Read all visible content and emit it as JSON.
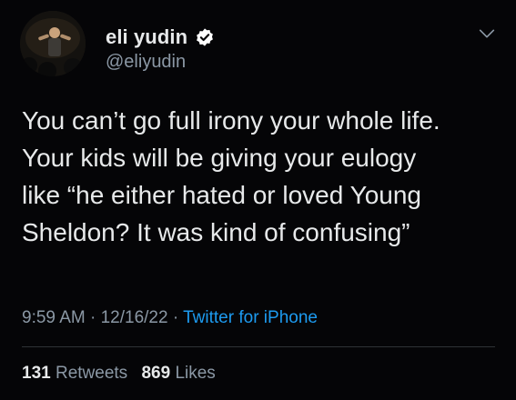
{
  "author": {
    "display_name": "eli yudin",
    "handle": "@eliyudin",
    "verified": true,
    "verified_color": "#ffffff",
    "avatar_icon": "avatar-photo"
  },
  "tweet": {
    "lines": [
      "You can’t go full irony your whole life.",
      "Your kids will be giving your eulogy",
      "like “he either hated or loved Young",
      "Sheldon? It was kind of confusing”"
    ]
  },
  "meta": {
    "time": "9:59 AM",
    "separator": "·",
    "date": "12/16/22",
    "source": "Twitter for iPhone"
  },
  "stats": {
    "retweets_count": "131",
    "retweets_label": "Retweets",
    "likes_count": "869",
    "likes_label": "Likes"
  },
  "colors": {
    "background": "#050507",
    "text": "#e7e9ea",
    "secondary": "#8b98a5",
    "link": "#1d9bf0",
    "divider": "#2f3336"
  },
  "icons": {
    "more": "chevron-down-icon",
    "verified": "verified-badge-icon"
  }
}
